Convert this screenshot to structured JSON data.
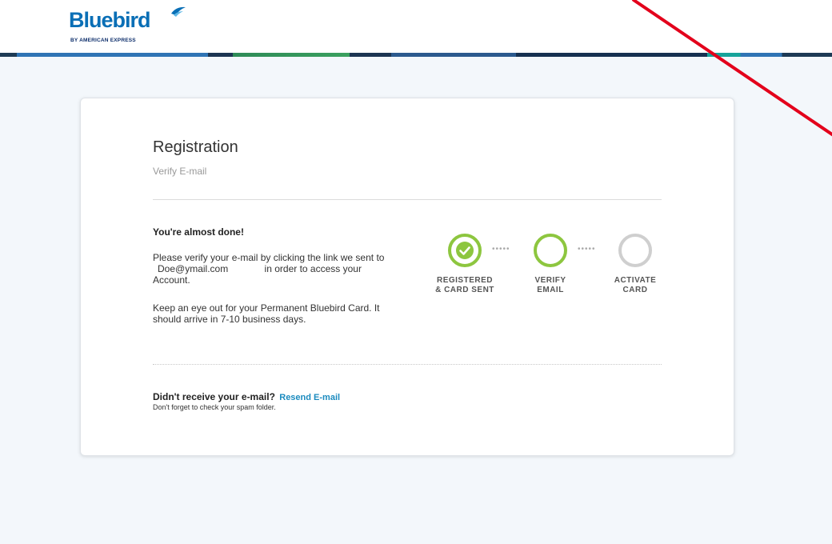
{
  "brand": {
    "name": "Bluebird",
    "byline": "BY AMERICAN EXPRESS",
    "colors": {
      "primary": "#0a6fb6",
      "accent_green": "#8dc63f",
      "link": "#1b8bbf"
    }
  },
  "card": {
    "title": "Registration",
    "subtitle": "Verify E-mail",
    "heading": "You're almost done!",
    "message_before": "Please verify your e-mail by clicking the link we sent to",
    "email": "Doe@ymail.com",
    "message_after": "in order to access your Account.",
    "card_notice": "Keep an eye out for your Permanent Bluebird Card. It should arrive in 7-10 business days.",
    "resend_prompt": "Didn't receive your e-mail?",
    "resend_link": "Resend E-mail",
    "spam_note": "Don't forget to check your spam folder."
  },
  "steps": [
    {
      "line1": "REGISTERED",
      "line2": "& CARD SENT",
      "state": "complete",
      "icon": "check-circle-icon"
    },
    {
      "line1": "VERIFY",
      "line2": "EMAIL",
      "state": "current",
      "icon": "ring-icon"
    },
    {
      "line1": "ACTIVATE",
      "line2": "CARD",
      "state": "pending",
      "icon": "ring-icon"
    }
  ],
  "step_separator": "•••••",
  "annotation": {
    "color": "#e3001b",
    "shape": "red-diagonal-line"
  }
}
